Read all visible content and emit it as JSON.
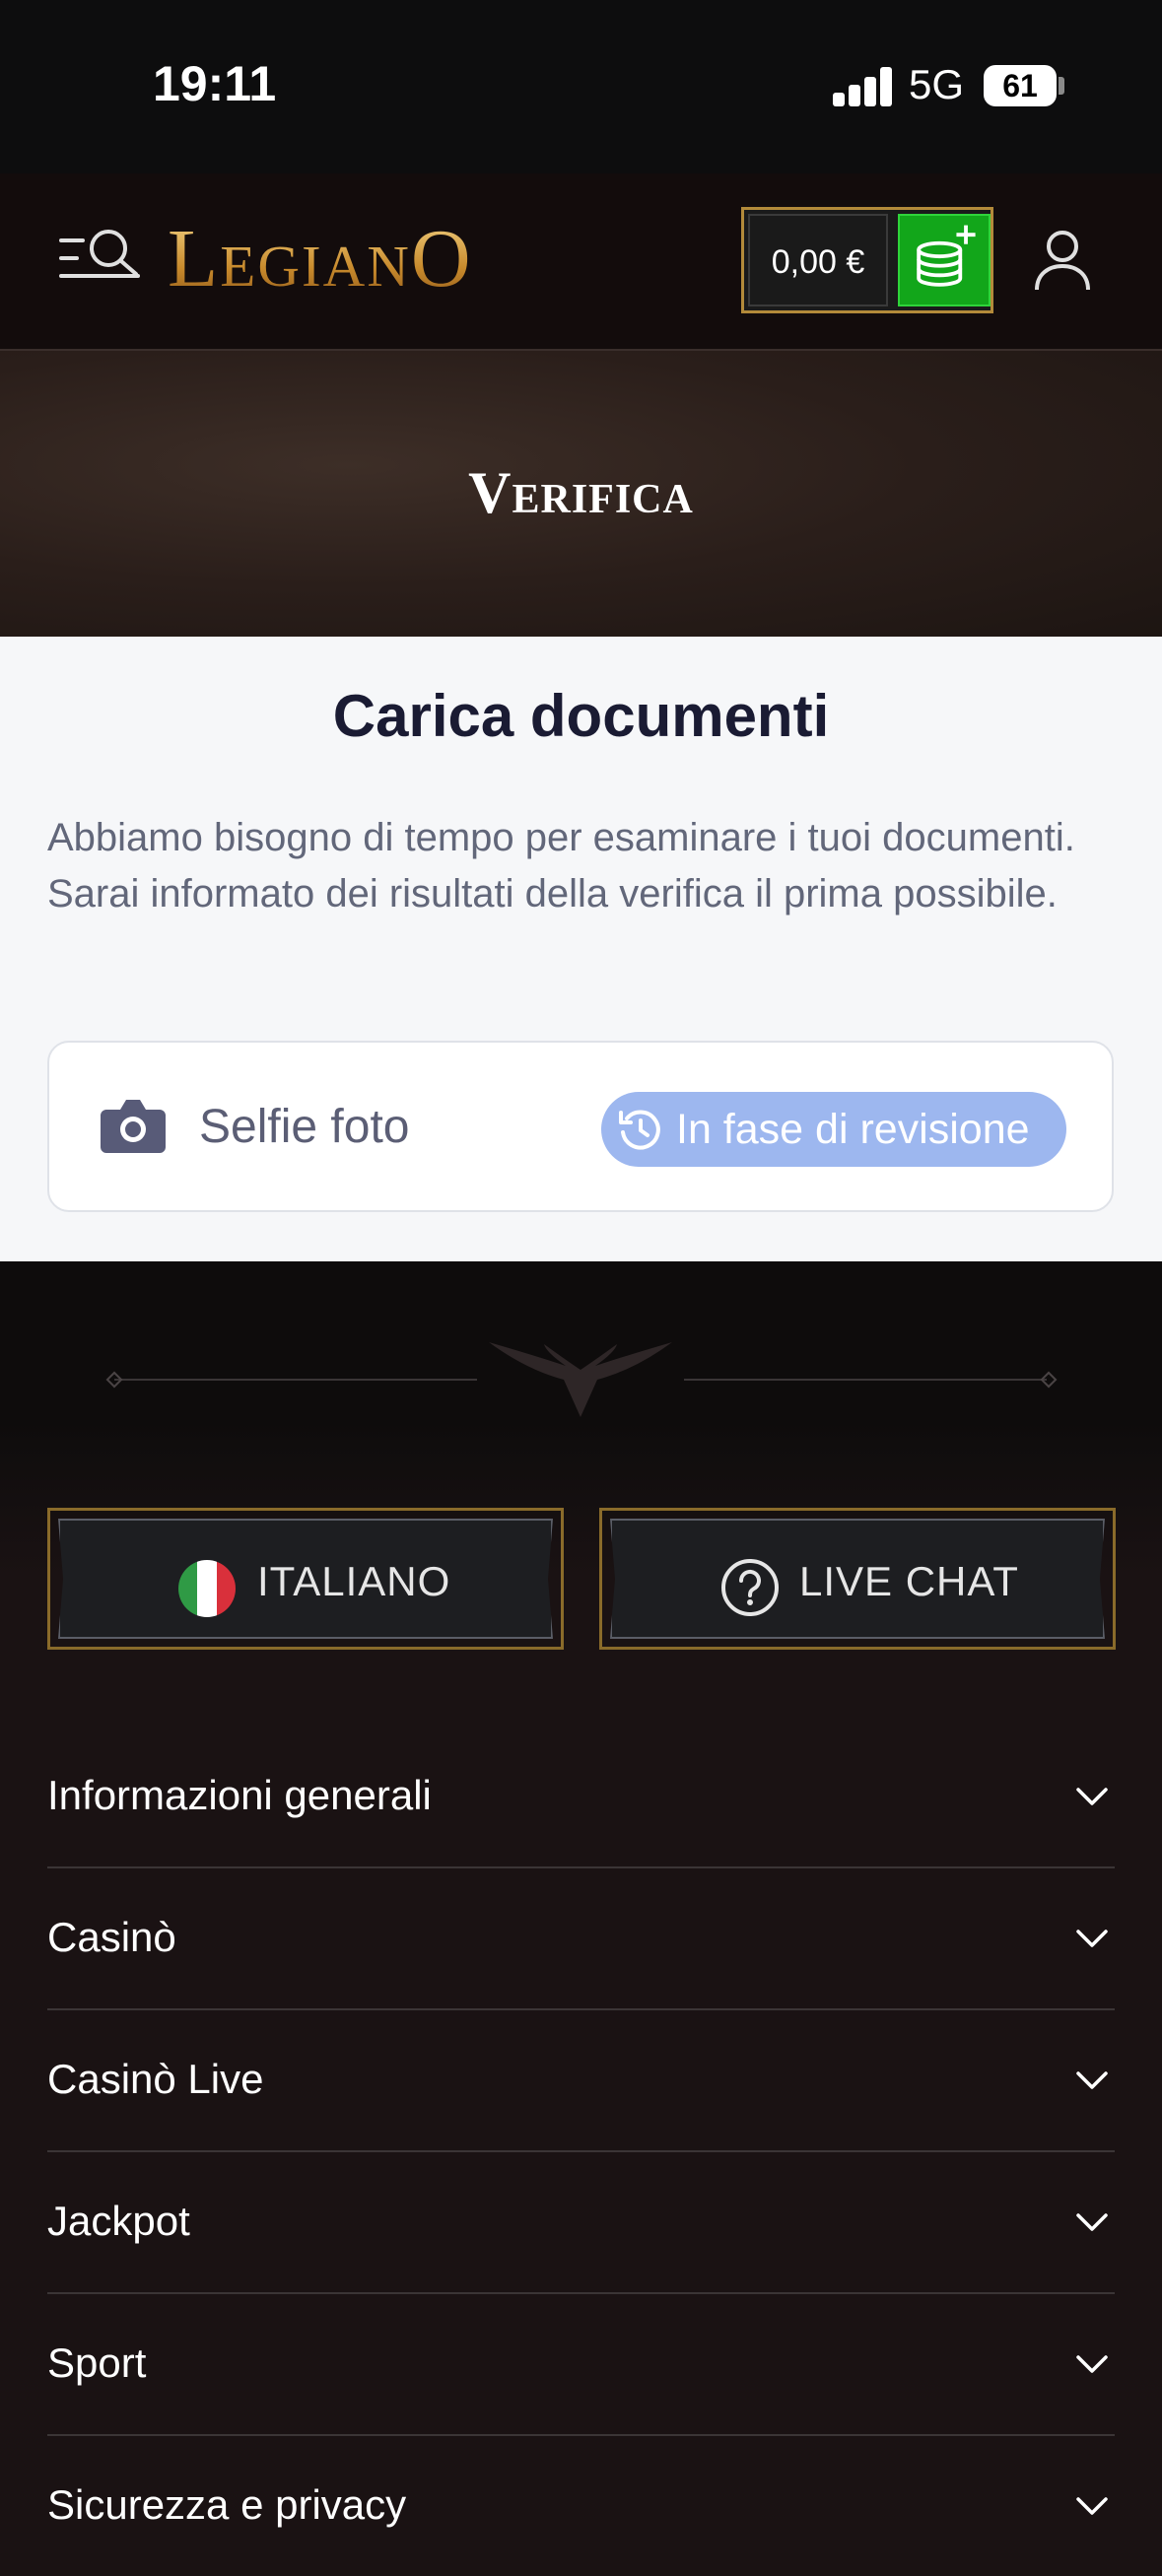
{
  "status_bar": {
    "time": "19:11",
    "network": "5G",
    "battery": "61"
  },
  "header": {
    "logo": "LegianO",
    "balance": "0,00 €"
  },
  "hero": {
    "title": "Verifica"
  },
  "content": {
    "title": "Carica documenti",
    "description": "Abbiamo bisogno di tempo per esaminare i tuoi documenti. Sarai informato dei risultati della verifica il prima possibile.",
    "document": {
      "label": "Selfie foto",
      "status": "In fase di revisione"
    }
  },
  "footer": {
    "language_button": "ITALIANO",
    "live_chat_button": "LIVE CHAT",
    "sections": [
      {
        "label": "Informazioni generali"
      },
      {
        "label": "Casinò"
      },
      {
        "label": "Casinò Live"
      },
      {
        "label": "Jackpot"
      },
      {
        "label": "Sport"
      },
      {
        "label": "Sicurezza e privacy"
      }
    ]
  },
  "colors": {
    "status_badge": "#9db7ef",
    "deposit": "#12a61a",
    "gold": "#d7a64a",
    "footer_bg": "#1a1213"
  }
}
